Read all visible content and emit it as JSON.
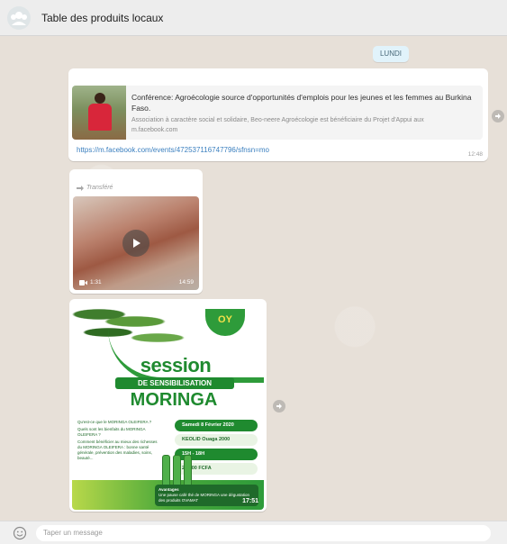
{
  "header": {
    "title": "Table des produits locaux",
    "avatar_icon": "group-icon"
  },
  "chat": {
    "day_label": "LUNDI",
    "link_message": {
      "preview_title": "Conférence: Agroécologie source d'opportunités d'emplois pour les jeunes et les femmes au Burkina Faso.",
      "preview_description": "Association à caractère social et solidaire, Beo-neere Agroécologie est bénéficiaire du Projet d'Appui aux",
      "preview_domain": "m.facebook.com",
      "link": "https://m.facebook.com/events/472537116747796/sfnsn=mo",
      "time": "12:48"
    },
    "video_message": {
      "forwarded_label": "Transféré",
      "duration": "1:31",
      "time": "14:59"
    },
    "image_message": {
      "poster_logo": "OY",
      "poster_title": "session",
      "poster_banner": "DE SENSIBILISATION",
      "poster_subject": "MORINGA",
      "poster_questions": [
        "Qu'est-ce que le MORINGA OLEIFERA ?",
        "Quels sont les bienfaits du MORINGA OLEIFERA ?",
        "Comment bénéficier au mieux des richesses du MORINGA OLEIFERA : bonne santé générale, prévention des maladies, soins, beauté..."
      ],
      "poster_date": "Samedi 8 Février 2020",
      "poster_place": "KEOLID Ouaga 2000",
      "poster_hours": "15H - 18H",
      "poster_price": "25.000 FCFA",
      "poster_avantages_title": "Avantages",
      "poster_avantages_text": "Une pause café thé de MORINGA une dégustation des produits OVAMAT",
      "time": "17:51"
    }
  },
  "composer": {
    "placeholder": "Taper un message",
    "emoji_icon": "smiley-icon"
  },
  "colors": {
    "chat_background": "#e7e0d8",
    "bubble": "#ffffff",
    "link": "#3a7fbf",
    "day_chip": "#e1f3fb",
    "poster_green": "#1f8a2f"
  }
}
